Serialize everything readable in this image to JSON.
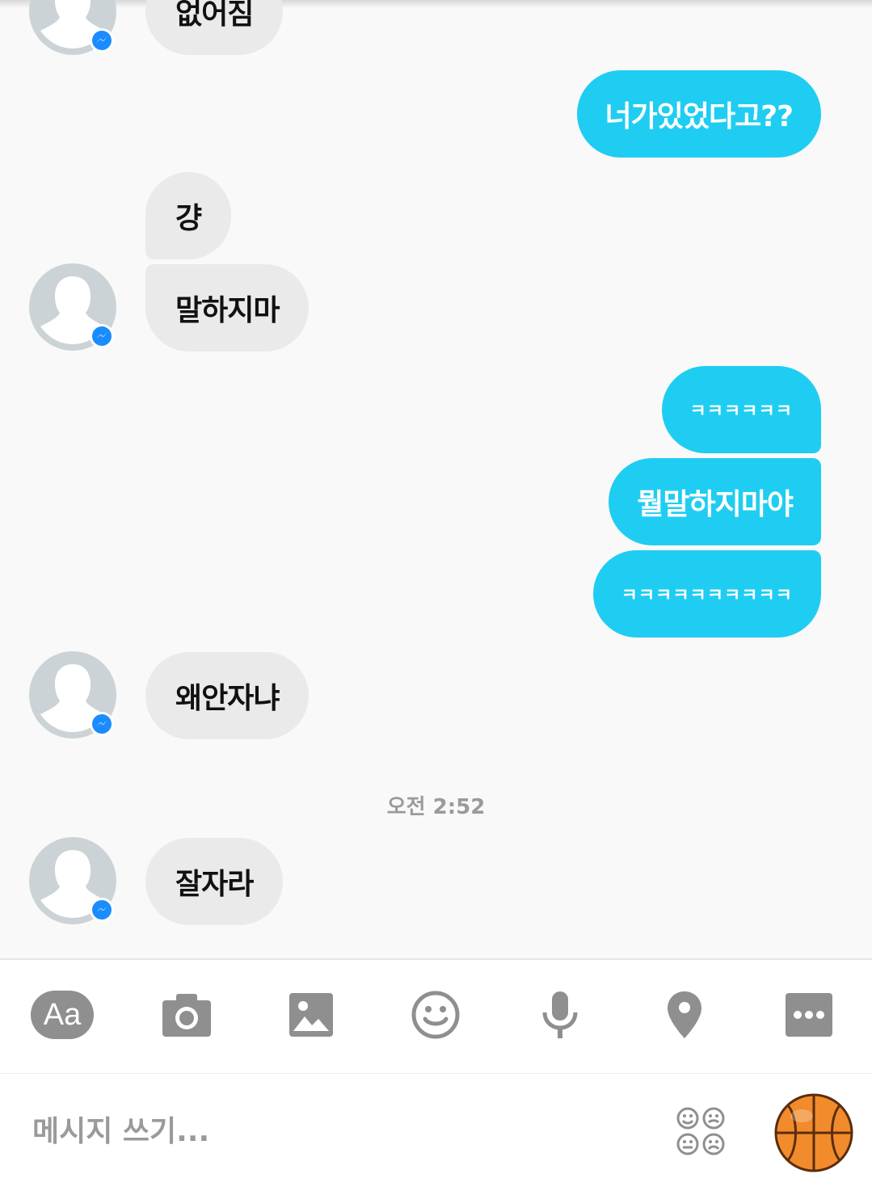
{
  "colors": {
    "incoming_bubble": "#eaeaea",
    "outgoing_bubble": "#1fcdf2",
    "messenger_badge": "#1a8cff",
    "toolbar_icon": "#8f8f8f"
  },
  "messages": [
    {
      "dir": "in",
      "text": "없어짐",
      "avatar": true
    },
    {
      "dir": "out",
      "text": "너가있었다고??"
    },
    {
      "dir": "in",
      "text": "걍",
      "avatar": false
    },
    {
      "dir": "in",
      "text": "말하지마",
      "avatar": true
    },
    {
      "dir": "out",
      "text": "ㅋㅋㅋㅋㅋㅋ"
    },
    {
      "dir": "out",
      "text": "뭘말하지마야"
    },
    {
      "dir": "out",
      "text": "ㅋㅋㅋㅋㅋㅋㅋㅋㅋㅋ"
    },
    {
      "dir": "in",
      "text": "왜안자냐",
      "avatar": true
    },
    {
      "dir": "in",
      "text": "잘자라",
      "avatar": true
    }
  ],
  "timestamp": "오전 2:52",
  "toolbar": {
    "text_mode_label": "Aa",
    "icons": [
      "camera-icon",
      "image-icon",
      "smiley-icon",
      "microphone-icon",
      "location-pin-icon",
      "more-icon"
    ]
  },
  "composer": {
    "placeholder": "메시지 쓰기...",
    "sticker_icon": "sticker-faces-icon",
    "quick_reaction_icon": "basketball-icon"
  }
}
